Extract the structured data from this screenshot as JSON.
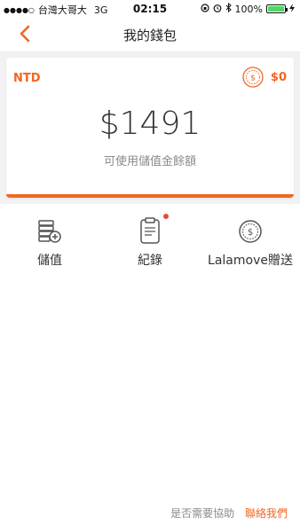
{
  "status_bar": {
    "carrier": "台灣大哥大",
    "network": "3G",
    "time": "02:15",
    "battery": "100%",
    "battery_level": 1.0,
    "icons": [
      "orientation-lock-icon",
      "alarm-icon",
      "bluetooth-icon",
      "battery-icon",
      "charging-icon"
    ]
  },
  "header": {
    "title": "我的錢包",
    "back_icon": "chevron-left-icon"
  },
  "wallet_card": {
    "currency": "NTD",
    "coin_amount": "$0",
    "balance": "$1491",
    "balance_label": "可使用儲值金餘額"
  },
  "actions": [
    {
      "label": "儲值",
      "icon": "top-up-icon"
    },
    {
      "label": "紀錄",
      "icon": "records-icon",
      "badge": true
    },
    {
      "label": "Lalamove贈送",
      "icon": "coin-gift-icon"
    }
  ],
  "help": {
    "question": "是否需要協助",
    "link": "聯絡我們"
  },
  "colors": {
    "accent": "#f16622",
    "badge": "#e64a3b",
    "background": "#f2f2f2"
  }
}
